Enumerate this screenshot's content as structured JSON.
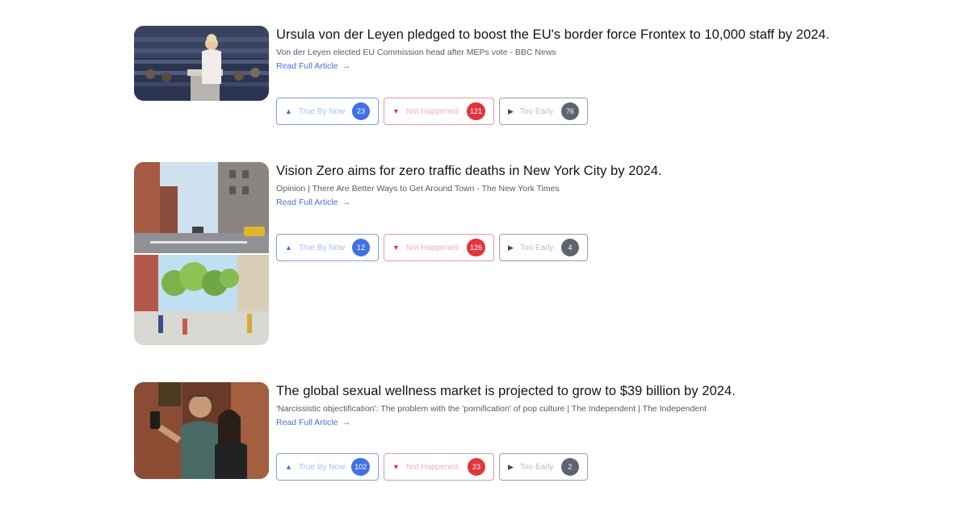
{
  "colors": {
    "true_accent": "#3f72e4",
    "not_accent": "#e0353c",
    "late_accent": "#5d6470",
    "link": "#4a6fd8"
  },
  "labels": {
    "read_more": "Read Full Article",
    "read_more_icon": "arrow-right-icon"
  },
  "articles": [
    {
      "image": "parliament-speech-photo",
      "title": "Ursula von der Leyen pledged to boost the EU's border force Frontex to 10,000 staff by 2024.",
      "source": "Von der Leyen elected EU Commission head after MEPs vote - BBC News",
      "votes": {
        "true": {
          "label": "True By Now",
          "count": "23"
        },
        "not": {
          "label": "Not Happened",
          "count": "121"
        },
        "late": {
          "label": "Too Early",
          "count": "76"
        }
      }
    },
    {
      "image": "nyc-street-before-after-photo",
      "title": "Vision Zero aims for zero traffic deaths in New York City by 2024.",
      "source": "Opinion | There Are Better Ways to Get Around Town - The New York Times",
      "votes": {
        "true": {
          "label": "True By Now",
          "count": "12"
        },
        "not": {
          "label": "Not Happened",
          "count": "126"
        },
        "late": {
          "label": "Too Early",
          "count": "4"
        }
      }
    },
    {
      "image": "bar-selfie-photo",
      "title": "The global sexual wellness market is projected to grow to $39 billion by 2024.",
      "source": "'Narcissistic objectification': The problem with the 'pornification' of pop culture | The Independent | The Independent",
      "votes": {
        "true": {
          "label": "True By Now",
          "count": "102"
        },
        "not": {
          "label": "Not Happened",
          "count": "23"
        },
        "late": {
          "label": "Too Early",
          "count": "2"
        }
      }
    }
  ]
}
